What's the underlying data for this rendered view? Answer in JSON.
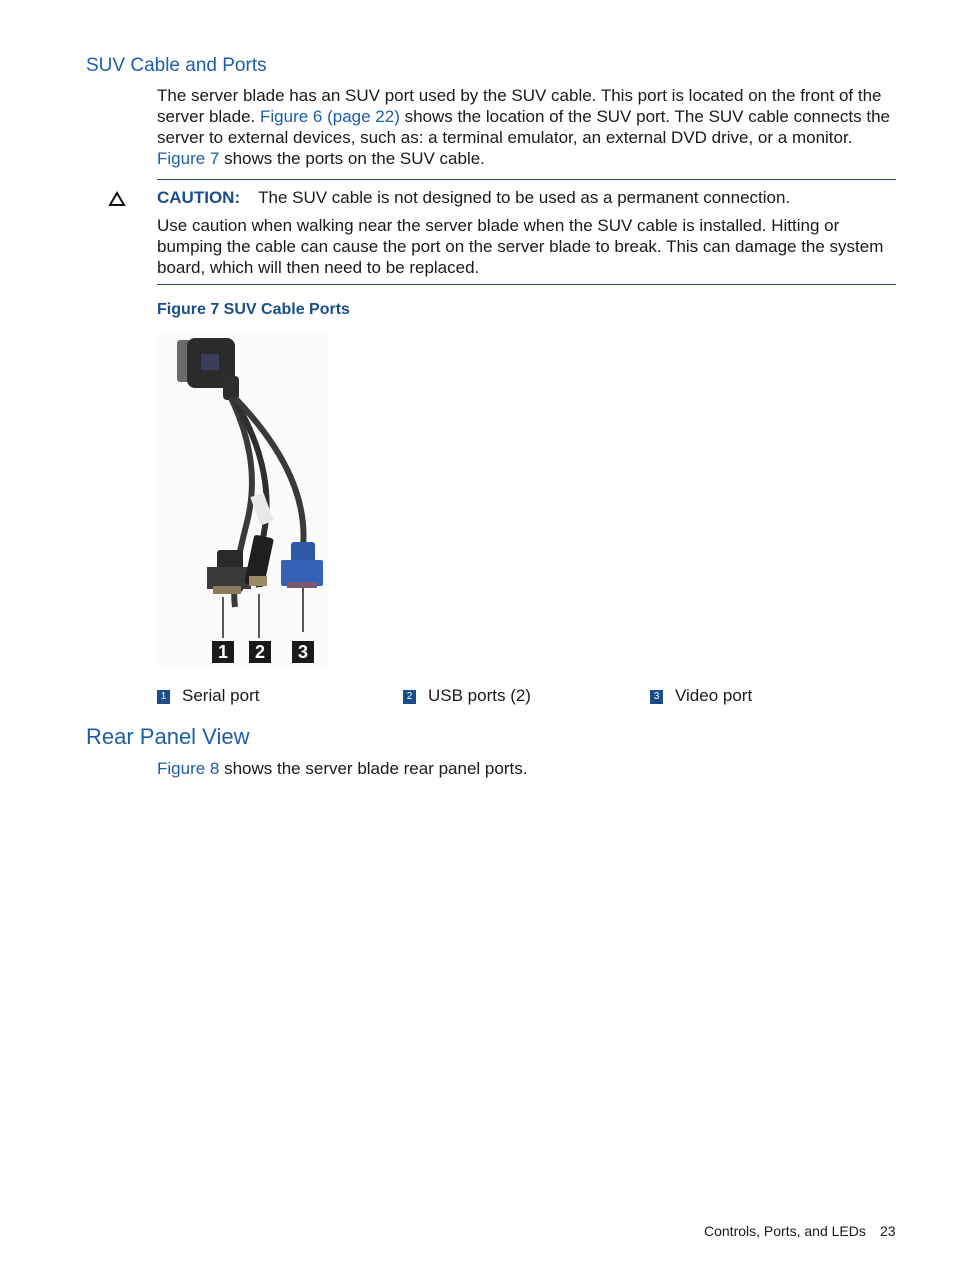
{
  "section1": {
    "heading": "SUV Cable and Ports",
    "para": {
      "part1": "The server blade has an SUV port used by the SUV cable. This port is located on the front of the server blade. ",
      "link1": "Figure 6 (page 22)",
      "part2": " shows the location of the SUV port. The SUV cable connects the server to external devices, such as: a terminal emulator, an external DVD drive, or a monitor. ",
      "link2": "Figure 7",
      "part3": " shows the ports on the SUV cable."
    }
  },
  "caution": {
    "icon": "warning-triangle-icon",
    "label": "CAUTION:",
    "line1": "The SUV cable is not designed to be used as a permanent connection.",
    "line2": "Use caution when walking near the server blade when the SUV cable is installed. Hitting or bumping the cable can cause the port on the server blade to break. This can damage the system board, which will then need to be replaced."
  },
  "figure": {
    "title": "Figure 7 SUV Cable Ports",
    "callouts": [
      "1",
      "2",
      "3"
    ],
    "legend": [
      {
        "num": "1",
        "label": "Serial port"
      },
      {
        "num": "2",
        "label": "USB ports (2)"
      },
      {
        "num": "3",
        "label": "Video port"
      }
    ]
  },
  "section2": {
    "heading": "Rear Panel View",
    "link": "Figure 8",
    "text": " shows the server blade rear panel ports."
  },
  "footer": {
    "chapter": "Controls, Ports, and LEDs",
    "page": "23"
  }
}
